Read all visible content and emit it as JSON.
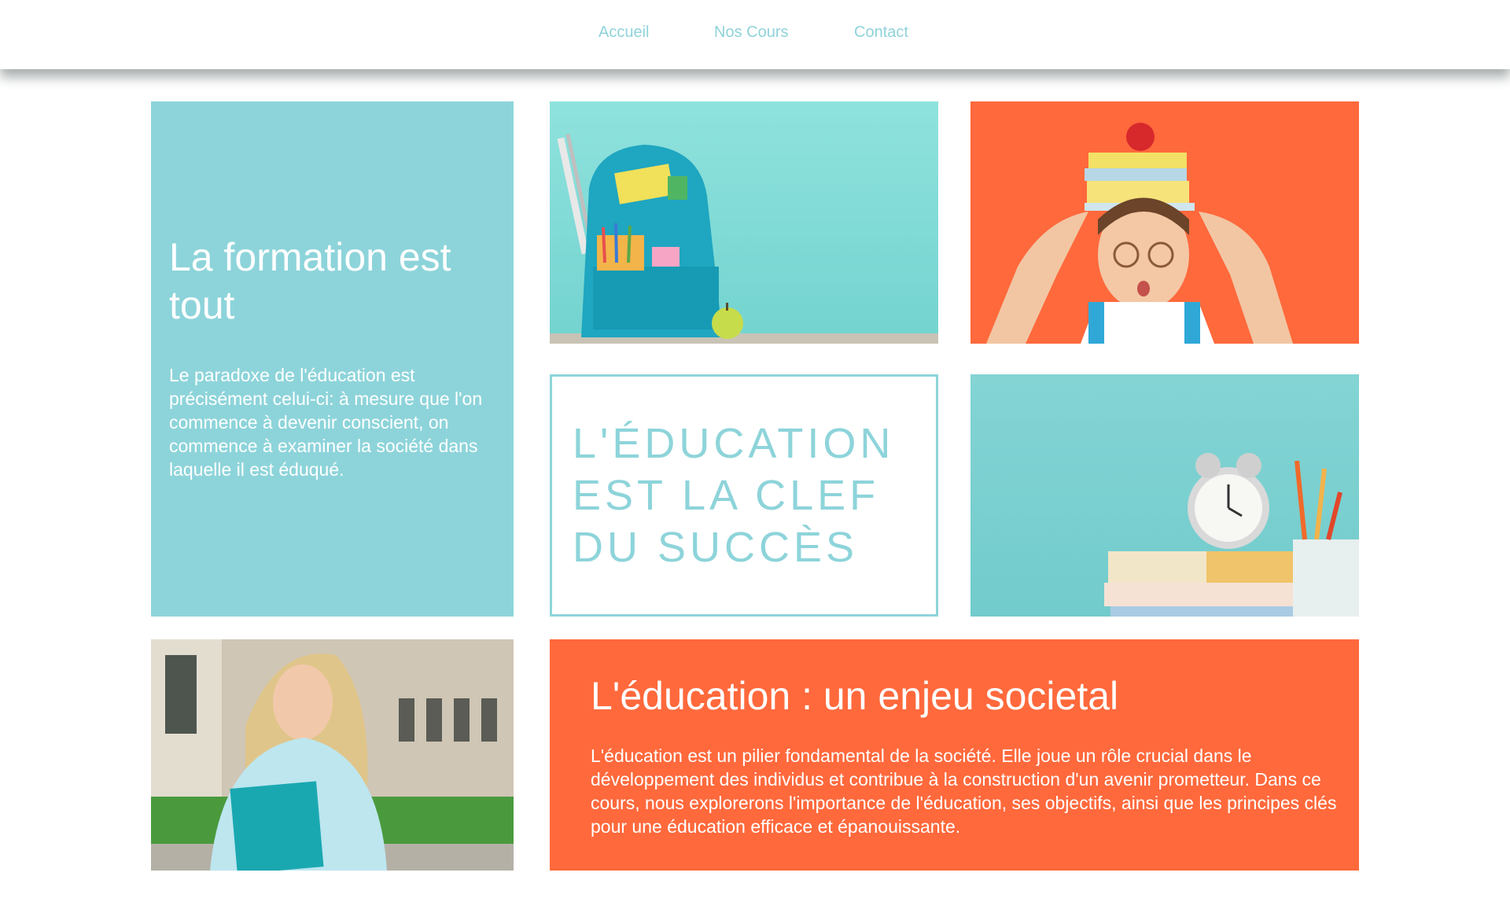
{
  "nav": {
    "items": [
      "Accueil",
      "Nos Cours",
      "Contact"
    ]
  },
  "intro": {
    "title": "La formation est tout",
    "text": "Le paradoxe de l'éducation est précisément celui-ci: à mesure que l'on commence à devenir conscient, on commence à examiner la société dans laquelle il est éduqué."
  },
  "quote": {
    "line1": "L'ÉDUCATION",
    "line2": "EST LA CLEF",
    "line3": "DU SUCCÈS"
  },
  "societal": {
    "title": "L'éducation : un enjeu societal",
    "text": "L'éducation est un pilier fondamental de la société. Elle joue un rôle crucial dans le développement des individus et contribue à la construction d'un avenir prometteur. Dans ce cours, nous explorerons l'importance de l'éducation, ses objectifs, ainsi que les principes clés pour une éducation efficace et épanouissante."
  },
  "colors": {
    "teal": "#8dd4da",
    "orange": "#ff693c",
    "nav_link": "#8fd3da"
  },
  "images": {
    "backpack": "school-backpack-photo",
    "student": "student-with-books-on-head-photo",
    "clock": "alarm-clock-on-books-photo",
    "girl": "student-girl-holding-folder-photo"
  }
}
